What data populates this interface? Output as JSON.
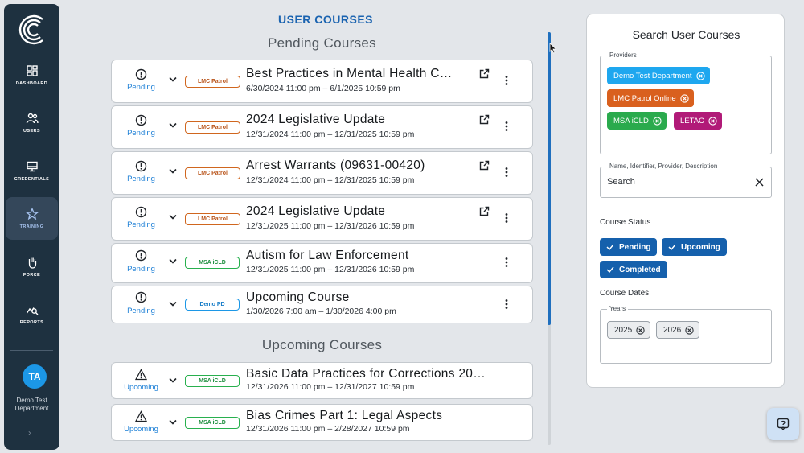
{
  "sidebar": {
    "items": [
      {
        "label": "DASHBOARD",
        "icon": "dashboard-icon"
      },
      {
        "label": "USERS",
        "icon": "users-icon"
      },
      {
        "label": "CREDENTIALS",
        "icon": "monitor-icon"
      },
      {
        "label": "TRAINING",
        "icon": "star-icon"
      },
      {
        "label": "FORCE",
        "icon": "hand-icon"
      },
      {
        "label": "REPORTS",
        "icon": "chart-search-icon"
      }
    ],
    "active_item": "TRAINING",
    "avatar_initials": "TA",
    "department": "Demo Test Department"
  },
  "main": {
    "title": "USER COURSES",
    "pending_heading": "Pending Courses",
    "upcoming_heading": "Upcoming Courses",
    "pending": [
      {
        "status": "Pending",
        "provider": "LMC Patrol",
        "title": "Best Practices in Mental Health C…",
        "dates": "6/30/2024 11:00 pm – 6/1/2025 10:59 pm",
        "external": true
      },
      {
        "status": "Pending",
        "provider": "LMC Patrol",
        "title": "2024 Legislative Update",
        "dates": "12/31/2024 11:00 pm – 12/31/2025 10:59 pm",
        "external": true
      },
      {
        "status": "Pending",
        "provider": "LMC Patrol",
        "title": "Arrest Warrants (09631-00420)",
        "dates": "12/31/2024 11:00 pm – 12/31/2025 10:59 pm",
        "external": true
      },
      {
        "status": "Pending",
        "provider": "LMC Patrol",
        "title": "2024 Legislative Update",
        "dates": "12/31/2025 11:00 pm – 12/31/2026 10:59 pm",
        "external": true
      },
      {
        "status": "Pending",
        "provider": "MSA iCLD",
        "title": "Autism for Law Enforcement",
        "dates": "12/31/2025 11:00 pm – 12/31/2026 10:59 pm",
        "external": false
      },
      {
        "status": "Pending",
        "provider": "Demo PD",
        "title": "Upcoming Course",
        "dates": "1/30/2026 7:00 am – 1/30/2026 4:00 pm",
        "external": false
      }
    ],
    "upcoming": [
      {
        "status": "Upcoming",
        "provider": "MSA iCLD",
        "title": "Basic Data Practices for Corrections 20…",
        "dates": "12/31/2026 11:00 pm – 12/31/2027 10:59 pm"
      },
      {
        "status": "Upcoming",
        "provider": "MSA iCLD",
        "title": "Bias Crimes Part 1: Legal Aspects",
        "dates": "12/31/2026 11:00 pm – 2/28/2027 10:59 pm"
      }
    ]
  },
  "search": {
    "title": "Search User Courses",
    "providers_label": "Providers",
    "providers": [
      "Demo Test Department",
      "LMC Patrol Online",
      "MSA iCLD",
      "LETAC"
    ],
    "query_label": "Name, Identifier, Provider, Description",
    "query_value": "Search",
    "status_label": "Course Status",
    "statuses": [
      "Pending",
      "Upcoming",
      "Completed"
    ],
    "dates_label": "Course Dates",
    "years_label": "Years",
    "years": [
      "2025",
      "2026"
    ]
  },
  "colors": {
    "sidebar_bg": "#1e3140",
    "accent": "#1560ac",
    "pending_status": "#1c7fd6"
  }
}
